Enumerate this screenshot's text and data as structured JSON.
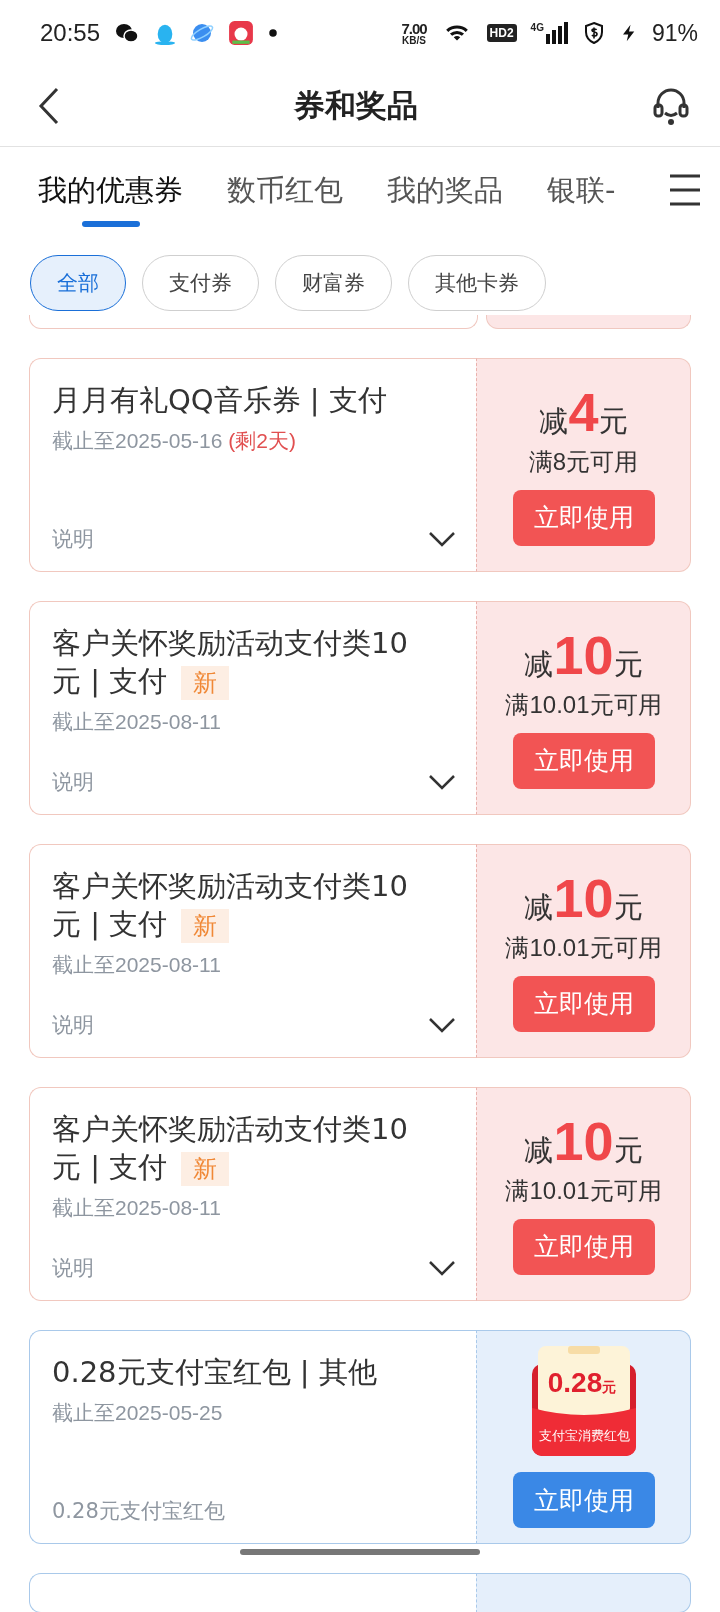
{
  "status_bar": {
    "time": "20:55",
    "speed": "7.00",
    "speed_unit": "KB/S",
    "hd": "HD2",
    "network": "4G",
    "battery": "91%"
  },
  "header": {
    "title": "券和奖品"
  },
  "tabs": [
    {
      "label": "我的优惠券",
      "selected": true
    },
    {
      "label": "数币红包",
      "selected": false
    },
    {
      "label": "我的奖品",
      "selected": false
    },
    {
      "label": "银联-",
      "selected": false
    }
  ],
  "filters": [
    {
      "label": "全部",
      "selected": true
    },
    {
      "label": "支付券",
      "selected": false
    },
    {
      "label": "财富券",
      "selected": false
    },
    {
      "label": "其他卡券",
      "selected": false
    }
  ],
  "coupons": [
    {
      "kind": "discount",
      "title": "月月有礼QQ音乐券 | 支付",
      "deadline": "截止至2025-05-16",
      "remaining": "(剩2天)",
      "detail": "说明",
      "prefix": "减",
      "amount": "4",
      "unit": "元",
      "condition": "满8元可用",
      "button": "立即使用"
    },
    {
      "kind": "discount",
      "title": "客户关怀奖励活动支付类10元 | 支付",
      "badge": "新",
      "deadline": "截止至2025-08-11",
      "detail": "说明",
      "prefix": "减",
      "amount": "10",
      "unit": "元",
      "condition": "满10.01元可用",
      "button": "立即使用"
    },
    {
      "kind": "discount",
      "title": "客户关怀奖励活动支付类10元 | 支付",
      "badge": "新",
      "deadline": "截止至2025-08-11",
      "detail": "说明",
      "prefix": "减",
      "amount": "10",
      "unit": "元",
      "condition": "满10.01元可用",
      "button": "立即使用"
    },
    {
      "kind": "discount",
      "title": "客户关怀奖励活动支付类10元 | 支付",
      "badge": "新",
      "deadline": "截止至2025-08-11",
      "detail": "说明",
      "prefix": "减",
      "amount": "10",
      "unit": "元",
      "condition": "满10.01元可用",
      "button": "立即使用"
    },
    {
      "kind": "red_packet",
      "title": "0.28元支付宝红包 | 其他",
      "deadline": "截止至2025-05-25",
      "note": "0.28元支付宝红包",
      "packet_amount": "0.28",
      "packet_unit": "元",
      "packet_label": "支付宝消费红包",
      "button": "立即使用"
    }
  ]
}
